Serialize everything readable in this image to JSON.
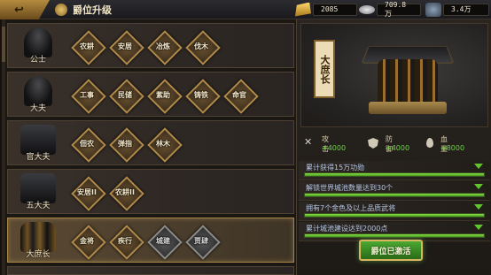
{
  "header": {
    "title": "爵位升级",
    "resources": {
      "gold": "2085",
      "silver": "709.8万",
      "iron": "3.4万"
    }
  },
  "ranks": [
    {
      "name": "公士",
      "skills": [
        {
          "label": "农耕",
          "locked": false
        },
        {
          "label": "安居",
          "locked": false
        },
        {
          "label": "冶炼",
          "locked": false
        },
        {
          "label": "伐木",
          "locked": false
        }
      ]
    },
    {
      "name": "大夫",
      "skills": [
        {
          "label": "工事",
          "locked": false
        },
        {
          "label": "民储",
          "locked": false
        },
        {
          "label": "紫助",
          "locked": false
        },
        {
          "label": "铸铁",
          "locked": false
        },
        {
          "label": "命官",
          "locked": false
        }
      ]
    },
    {
      "name": "官大夫",
      "skills": [
        {
          "label": "佃农",
          "locked": false
        },
        {
          "label": "弹指",
          "locked": false
        },
        {
          "label": "林木",
          "locked": false
        }
      ]
    },
    {
      "name": "五大夫",
      "skills": [
        {
          "label": "安居II",
          "locked": false
        },
        {
          "label": "农耕II",
          "locked": false
        }
      ]
    },
    {
      "name": "大庶长",
      "skills": [
        {
          "label": "金将",
          "locked": false
        },
        {
          "label": "疾行",
          "locked": false
        },
        {
          "label": "城建",
          "locked": true
        },
        {
          "label": "贾肆",
          "locked": true
        }
      ]
    }
  ],
  "detail": {
    "rank_title": "大庶长",
    "stats": {
      "attack_label": "攻击",
      "attack_value": "+4000",
      "defense_label": "防御",
      "defense_value": "+4000",
      "hp_label": "血量",
      "hp_value": "+8000"
    },
    "conditions": [
      {
        "text": "累计获得15万功勋",
        "progress": 1.0
      },
      {
        "text": "解锁世界城池数量达到30个",
        "progress": 1.0
      },
      {
        "text": "拥有7个金色及以上品质武将",
        "progress": 1.0
      },
      {
        "text": "累计城池建设达到2000点",
        "progress": 1.0
      }
    ],
    "button_label": "爵位已激活"
  }
}
